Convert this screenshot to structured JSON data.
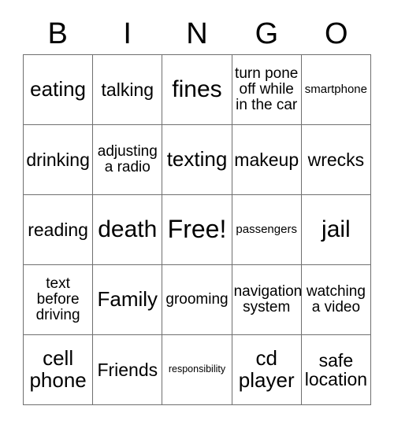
{
  "card": {
    "title": "BINGO",
    "header_letters": [
      "B",
      "I",
      "N",
      "G",
      "O"
    ],
    "rows": [
      [
        {
          "text": "eating",
          "size": "lg"
        },
        {
          "text": "talking",
          "size": "md"
        },
        {
          "text": "fines",
          "size": "xl"
        },
        {
          "text": "turn pone\noff while\nin the car",
          "size": "sm"
        },
        {
          "text": "smartphone",
          "size": "xs"
        }
      ],
      [
        {
          "text": "drinking",
          "size": "md"
        },
        {
          "text": "adjusting\na radio",
          "size": "sm"
        },
        {
          "text": "texting",
          "size": "lg"
        },
        {
          "text": "makeup",
          "size": "md"
        },
        {
          "text": "wrecks",
          "size": "md"
        }
      ],
      [
        {
          "text": "reading",
          "size": "md"
        },
        {
          "text": "death",
          "size": "xl"
        },
        {
          "text": "Free!",
          "size": "xxl"
        },
        {
          "text": "passengers",
          "size": "xs"
        },
        {
          "text": "jail",
          "size": "xl"
        }
      ],
      [
        {
          "text": "text\nbefore\ndriving",
          "size": "sm"
        },
        {
          "text": "Family",
          "size": "lg"
        },
        {
          "text": "grooming",
          "size": "sm"
        },
        {
          "text": "navigation\nsystem",
          "size": "sm"
        },
        {
          "text": "watching\na video",
          "size": "sm"
        }
      ],
      [
        {
          "text": "cell\nphone",
          "size": "lg"
        },
        {
          "text": "Friends",
          "size": "md"
        },
        {
          "text": "responsibility",
          "size": "xxs"
        },
        {
          "text": "cd\nplayer",
          "size": "lg"
        },
        {
          "text": "safe\nlocation",
          "size": "md"
        }
      ]
    ],
    "free_space": {
      "label": "Free!",
      "row": 2,
      "col": 2
    },
    "colors": {
      "background": "#ffffff",
      "text": "#000000",
      "grid_line": "#6f6f6f"
    }
  }
}
